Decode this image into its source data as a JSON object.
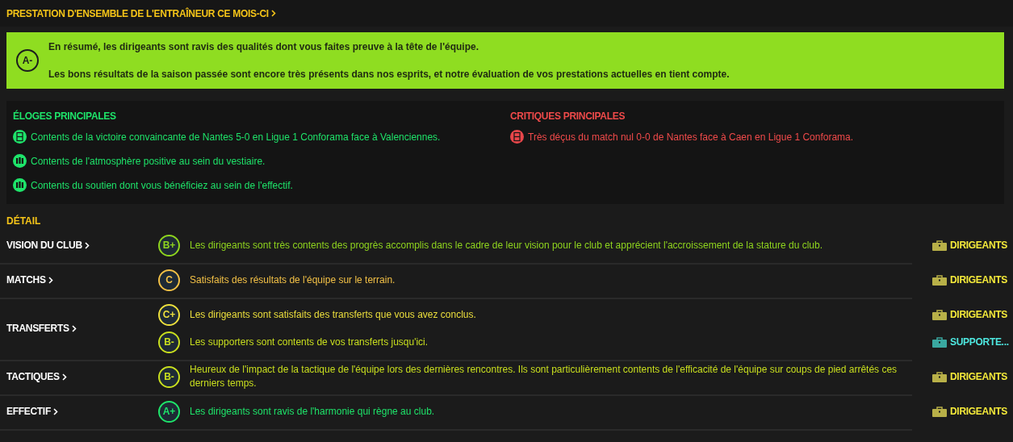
{
  "title": "PRESTATION D'ENSEMBLE DE L'ENTRAÎNEUR CE MOIS-CI",
  "summary": {
    "grade": "A-",
    "lines": [
      "En résumé, les dirigeants sont ravis des qualités dont vous faites preuve à la tête de l'équipe.",
      "Les bons résultats de la saison passée sont encore très présents dans nos esprits, et notre évaluation de vos prestations actuelles en tient compte."
    ]
  },
  "praise": {
    "heading": "ÉLOGES PRINCIPALES",
    "items": [
      {
        "kind": "pitch",
        "text": "Contents de la victoire convaincante de Nantes 5-0 en Ligue 1 Conforama face à Valenciennes."
      },
      {
        "kind": "group",
        "text": "Contents de l'atmosphère positive au sein du vestiaire."
      },
      {
        "kind": "group",
        "text": "Contents du soutien dont vous bénéficiez au sein de l'effectif."
      }
    ]
  },
  "criticism": {
    "heading": "CRITIQUES PRINCIPALES",
    "items": [
      {
        "kind": "pitch",
        "text": "Très déçus du match nul 0-0 de Nantes face à Caen en Ligue 1 Conforama."
      }
    ]
  },
  "detail": {
    "heading": "DÉTAIL",
    "sections": [
      {
        "label": "VISION DU CLUB",
        "entries": [
          {
            "grade": "B+",
            "color": "#8fd41e",
            "text": "Les dirigeants sont très contents des progrès accomplis dans le cadre de leur vision pour le club et apprécient l'accroissement de la stature du club.",
            "source": {
              "kind": "board",
              "label": "DIRIGEANTS"
            }
          }
        ]
      },
      {
        "label": "MATCHS",
        "entries": [
          {
            "grade": "C",
            "color": "#f2c046",
            "text": "Satisfaits des résultats de l'équipe sur le terrain.",
            "source": {
              "kind": "board",
              "label": "DIRIGEANTS"
            }
          }
        ]
      },
      {
        "label": "TRANSFERTS",
        "entries": [
          {
            "grade": "C+",
            "color": "#ecdf3c",
            "text": "Les dirigeants sont satisfaits des transferts que vous avez conclus.",
            "source": {
              "kind": "board",
              "label": "DIRIGEANTS"
            }
          },
          {
            "grade": "B-",
            "color": "#c9df1e",
            "text": "Les supporters sont contents de vos transferts jusqu'ici.",
            "source": {
              "kind": "supporters",
              "label": "SUPPORTE..."
            }
          }
        ]
      },
      {
        "label": "TACTIQUES",
        "entries": [
          {
            "grade": "B-",
            "color": "#c9df1e",
            "text": "Heureux de l'impact de la tactique de l'équipe lors des dernières rencontres. Ils sont particulièrement contents de l'efficacité de l'équipe sur coups de pied arrêtés ces derniers temps.",
            "source": {
              "kind": "board",
              "label": "DIRIGEANTS"
            }
          }
        ]
      },
      {
        "label": "EFFECTIF",
        "entries": [
          {
            "grade": "A+",
            "color": "#1ee46a",
            "text": "Les dirigeants sont ravis de l'harmonie qui règne au club.",
            "source": {
              "kind": "board",
              "label": "DIRIGEANTS"
            }
          }
        ]
      }
    ]
  }
}
